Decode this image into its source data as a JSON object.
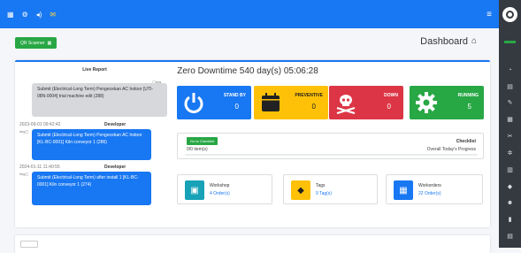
{
  "page": {
    "title": "Dashboard",
    "qr_label": "QR Scanner"
  },
  "downtime": "Zero Downtime 540 day(s) 05:06:28",
  "stats": [
    {
      "label": "RUNNING",
      "value": "5",
      "color": "#28a745"
    },
    {
      "label": "DOWN",
      "value": "0",
      "color": "#dc3545"
    },
    {
      "label": "PREVENTIVE",
      "value": "0",
      "color": "#ffc107"
    },
    {
      "label": "STAND BY",
      "value": "0",
      "color": "#1877f2"
    }
  ],
  "checklist": {
    "title": "Checklist",
    "subtitle": "Overall Today's Progress",
    "goto": "Go to Checklist",
    "done": "0/0 item(s)"
  },
  "minis": [
    {
      "label": "Workorders",
      "link": "22 Order(s)"
    },
    {
      "label": "Tags",
      "link": "9 Tag(s)"
    },
    {
      "label": "Workshop",
      "link": "4 Order(s)"
    }
  ],
  "live": {
    "title": "Live Report",
    "messages": [
      {
        "who": "",
        "time": "",
        "text": "Submit (Electrical-Long Term) Pengecekan AC Indoor [UTI-08N-0004] trial machine edit (288)"
      },
      {
        "who": "Developer",
        "time": "2023-09-01 09:42:42",
        "text": "Submit (Electrical-Long Term) Pengecekan AC Indoor [KL-BC-0001] Kiln conveyor 1 (286)"
      },
      {
        "who": "Developer",
        "time": "2024-01-11 11:40:55",
        "text": "Submit (Electrical-Long Term) after install 1 [KL-BC-0001] Kiln conveyor 1 (274)"
      }
    ]
  },
  "icons": {
    "menu": "hamburger-icon",
    "home": "home-icon",
    "running": "gear-icon",
    "down": "skull-icon",
    "preventive": "calendar-icon",
    "standby": "power-icon",
    "workorders": "calendar-icon",
    "tags": "tag-icon",
    "workshop": "toolbox-icon"
  }
}
